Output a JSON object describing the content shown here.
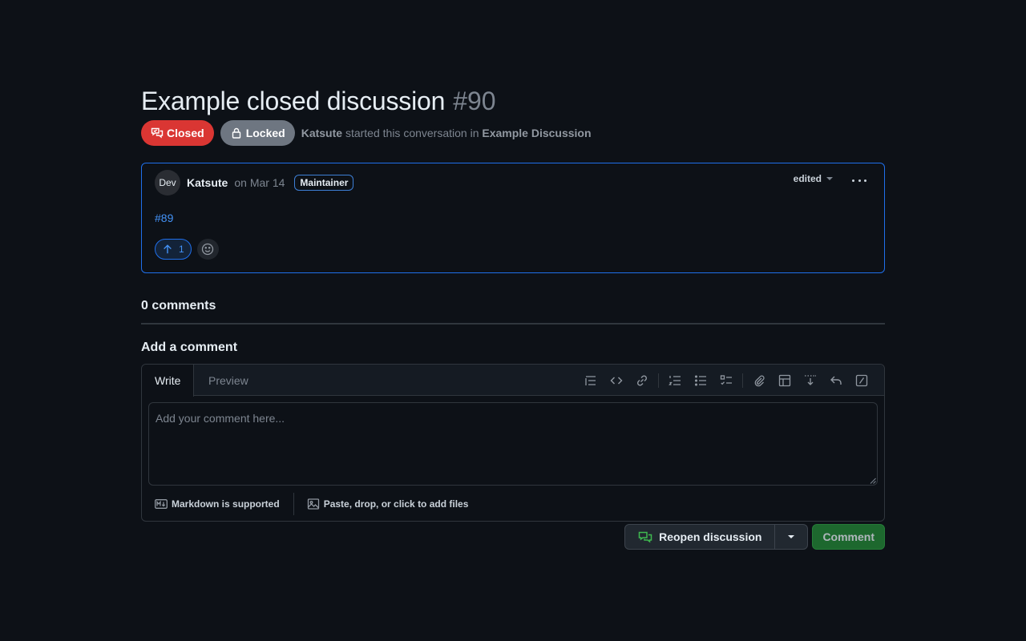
{
  "discussion": {
    "title": "Example closed discussion",
    "number": "#90",
    "state_label": "Closed",
    "lock_label": "Locked",
    "author": "Katsute",
    "started_text": "started this conversation in",
    "category": "Example Discussion"
  },
  "post": {
    "avatar_text": "Dev",
    "author": "Katsute",
    "date": "on Mar 14",
    "role": "Maintainer",
    "edited_label": "edited",
    "body_link": "#89",
    "upvote_count": "1"
  },
  "comments": {
    "count_label": "0 comments",
    "add_heading": "Add a comment"
  },
  "editor": {
    "tab_write": "Write",
    "tab_preview": "Preview",
    "placeholder": "Add your comment here...",
    "markdown_note": "Markdown is supported",
    "files_note": "Paste, drop, or click to add files",
    "toolbar_icons": [
      "heading-icon",
      "code-icon",
      "link-icon",
      "ordered-list-icon",
      "unordered-list-icon",
      "task-list-icon",
      "paperclip-icon",
      "table-icon",
      "insert-icon",
      "reply-icon",
      "slash-command-icon"
    ]
  },
  "actions": {
    "reopen_label": "Reopen discussion",
    "comment_label": "Comment"
  },
  "colors": {
    "background": "#0d1117",
    "closed": "#da3633",
    "locked": "#6e7681",
    "accent_blue": "#4493f8",
    "comment_green": "#238636"
  }
}
